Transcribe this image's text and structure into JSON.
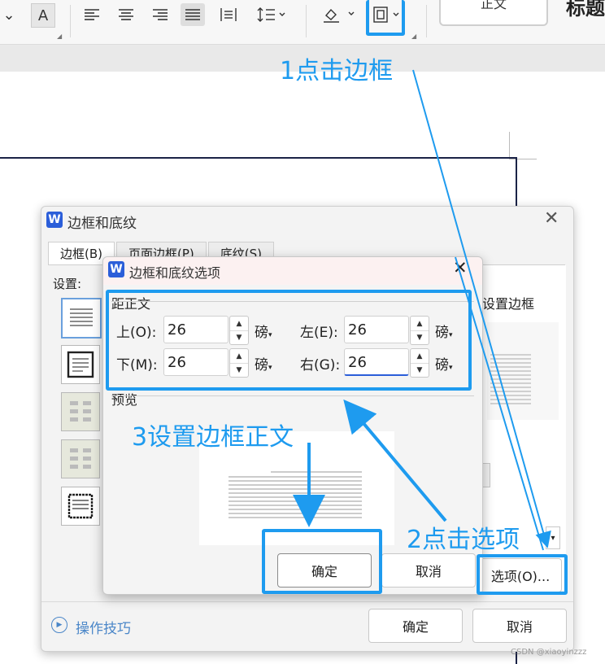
{
  "ribbon": {
    "style_text": "正文",
    "style_title": "标题"
  },
  "outer_dialog": {
    "title": "边框和底纹",
    "tabs": [
      "边框(B)",
      "页面边框(P)",
      "底纹(S)"
    ],
    "settings_label": "设置:",
    "right_label": "设置边框",
    "options_button": "选项(O)...",
    "ok_button": "确定",
    "cancel_button": "取消",
    "tips_link": "操作技巧"
  },
  "inner_dialog": {
    "title": "边框和底纹选项",
    "group_label": "距正文",
    "fields": {
      "top": {
        "label": "上(O):",
        "value": "26",
        "unit": "磅"
      },
      "bottom": {
        "label": "下(M):",
        "value": "26",
        "unit": "磅"
      },
      "left": {
        "label": "左(E):",
        "value": "26",
        "unit": "磅"
      },
      "right": {
        "label": "右(G):",
        "value": "26",
        "unit": "磅"
      }
    },
    "preview_label": "预览",
    "ok_button": "确定",
    "cancel_button": "取消"
  },
  "annotations": {
    "step1": "1点击边框",
    "step2": "2点击选项",
    "step3": "3设置边框正文"
  },
  "watermark": "CSDN @xiaoyinzzz",
  "colors": {
    "annotation": "#1e9bef",
    "word_logo": "#2b5ed9",
    "page_border": "#1b2347"
  }
}
